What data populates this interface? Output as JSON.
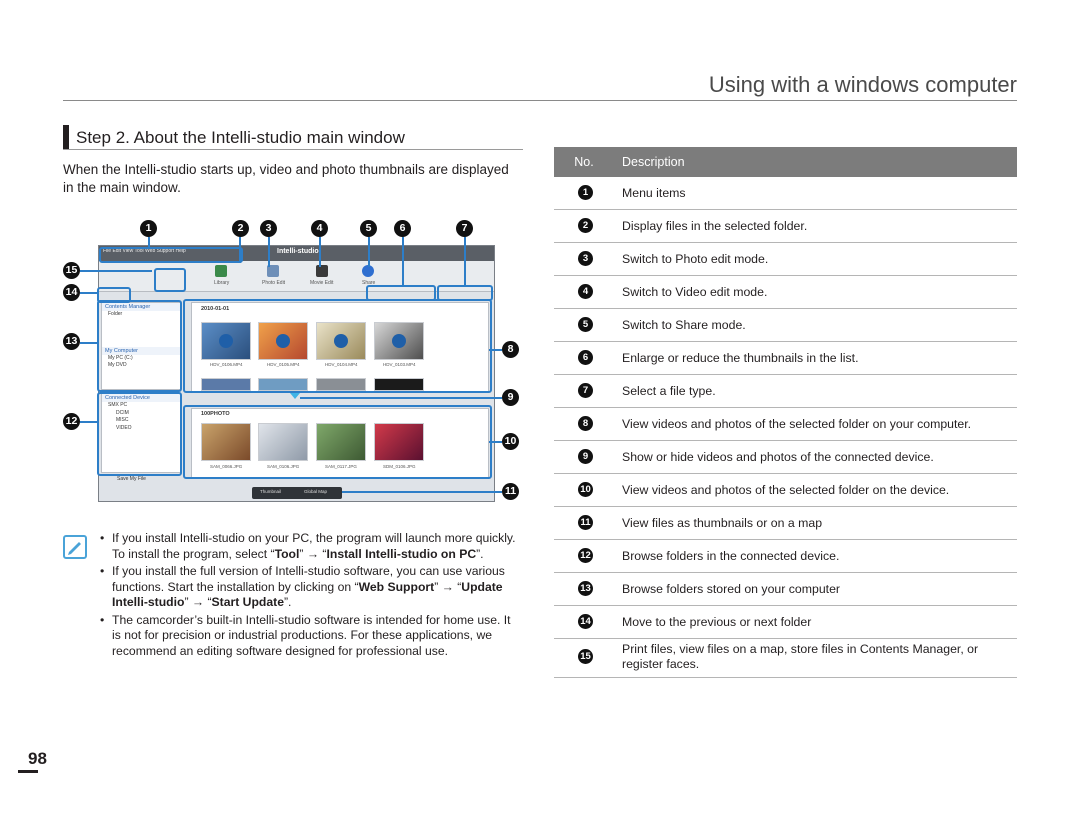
{
  "header": {
    "section_title": "Using with a windows computer"
  },
  "step": {
    "title": "Step 2. About the Intelli-studio main window"
  },
  "intro": "When the Intelli-studio starts up, video and photo thumbnails are displayed in the main window.",
  "screenshot": {
    "callouts": [
      "1",
      "2",
      "3",
      "4",
      "5",
      "6",
      "7",
      "8",
      "9",
      "10",
      "11",
      "12",
      "13",
      "14",
      "15"
    ],
    "menu_text": "File   Edit   View   Tool   Web Support   Help",
    "brand": "Intelli-studio",
    "toolbar_labels": [
      "Library",
      "Photo Edit",
      "Movie Edit",
      "Share"
    ],
    "contents_manager": "Contents Manager",
    "folder_label": "Folder",
    "my_computer": "My Computer",
    "my_computer_items": [
      "My PC (C:)",
      "My DVD"
    ],
    "connected_device": "Connected Device",
    "device_items": [
      "SMX PC",
      "DCIM",
      "MISC",
      "VIDEO"
    ],
    "save_file": "Save My File",
    "date_label": "2010-01-01",
    "folder_photo": "100PHOTO",
    "video_files": [
      "HDV_0106.MP4",
      "HDV_0105.MP4",
      "HDV_0104.MP4",
      "HDV_0103.MP4"
    ],
    "photo_files": [
      "SAM_0066.JPG",
      "SAM_0106.JPG",
      "SAM_0117.JPG",
      "SDM_0106.JPG"
    ],
    "tabs": [
      "Thumbnail",
      "Global Map"
    ]
  },
  "notes": {
    "items": [
      {
        "pre": "If you install Intelli-studio on your PC, the program will launch more quickly. To install the program, select “",
        "b1": "Tool",
        "mid": "” → “",
        "b2": "Install Intelli-studio on PC",
        "post": "”."
      },
      {
        "pre": "If you install the full version of Intelli-studio software, you can use various functions. Start the installation by clicking on “",
        "b1": "Web Support",
        "mid": "” → “",
        "b2": "Update Intelli-studio",
        "mid2": "” → “",
        "b3": "Start Update",
        "post": "”."
      },
      {
        "text": "The camcorder’s built-in Intelli-studio software is intended for home use. It is not for precision or industrial productions. For these applications, we recommend an editing software designed for professional use."
      }
    ]
  },
  "table": {
    "col_no": "No.",
    "col_desc": "Description",
    "rows": [
      {
        "no": "1",
        "desc": "Menu items"
      },
      {
        "no": "2",
        "desc": "Display files in the selected folder."
      },
      {
        "no": "3",
        "desc": "Switch to Photo edit mode."
      },
      {
        "no": "4",
        "desc": "Switch to Video edit mode."
      },
      {
        "no": "5",
        "desc": "Switch to Share mode."
      },
      {
        "no": "6",
        "desc": "Enlarge or reduce the thumbnails in the list."
      },
      {
        "no": "7",
        "desc": "Select a file type."
      },
      {
        "no": "8",
        "desc": "View videos and photos of the selected folder on your computer."
      },
      {
        "no": "9",
        "desc": "Show or hide videos and photos of the connected device."
      },
      {
        "no": "10",
        "desc": "View videos and photos of the selected folder on the device."
      },
      {
        "no": "11",
        "desc": "View files as thumbnails or on a map"
      },
      {
        "no": "12",
        "desc": "Browse folders in the connected device."
      },
      {
        "no": "13",
        "desc": "Browse folders stored on your computer"
      },
      {
        "no": "14",
        "desc": "Move to the previous or next folder"
      },
      {
        "no": "15",
        "desc": "Print files, view files on a map, store files in Contents Manager, or register faces."
      }
    ]
  },
  "page_number": "98"
}
